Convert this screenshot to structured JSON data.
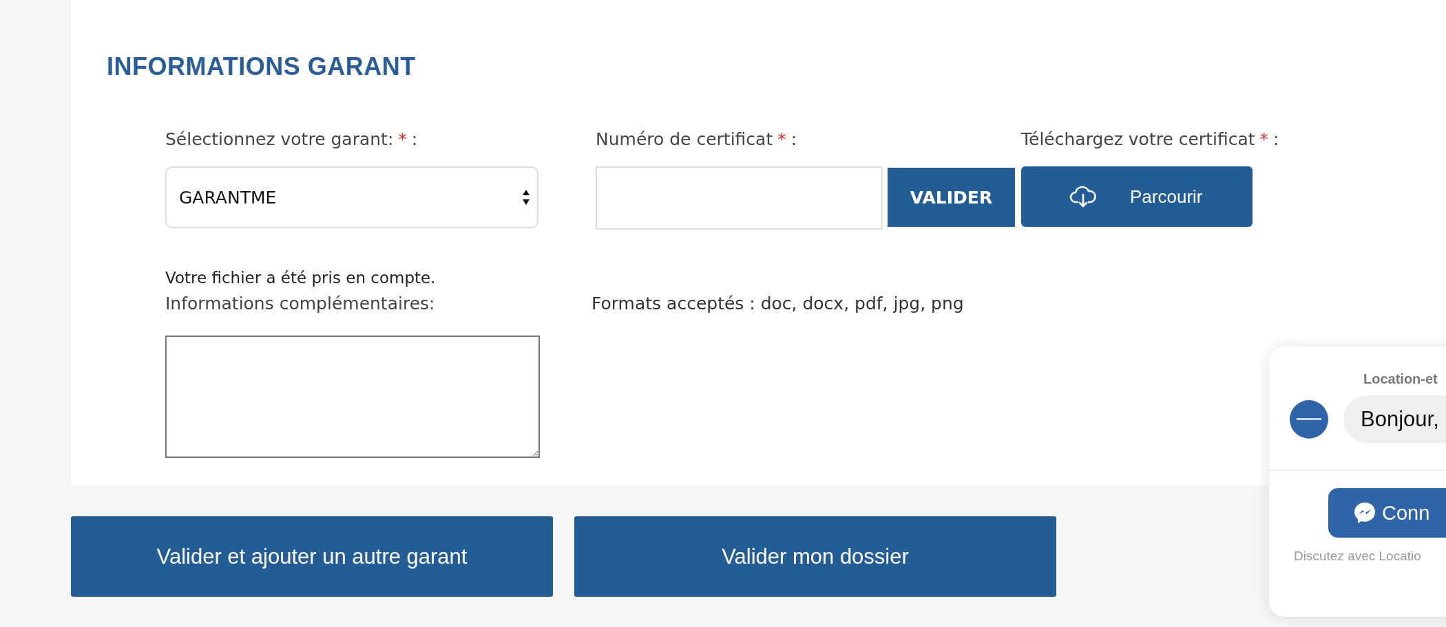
{
  "section": {
    "title": "INFORMATIONS GARANT"
  },
  "required_mark": "*",
  "label_suffix": ":",
  "guarantor": {
    "label": "Sélectionnez votre garant:",
    "required": true,
    "value": "GARANTME"
  },
  "certificate": {
    "label": "Numéro de certificat",
    "required": true,
    "button": "VALIDER"
  },
  "upload": {
    "label": "Téléchargez votre certificat",
    "required": true,
    "button": "Parcourir",
    "formats": "Formats acceptés : doc, docx, pdf, jpg, png"
  },
  "file_status": "Votre fichier a été pris en compte.",
  "notes": {
    "label": "Informations complémentaires:"
  },
  "actions": [
    "Valider et ajouter un autre garant",
    "Valider mon dossier"
  ],
  "chat_widget": {
    "sender": "Location-et",
    "message": "Bonjour,",
    "button": "Conn",
    "footer": "Discutez avec Locatio"
  }
}
